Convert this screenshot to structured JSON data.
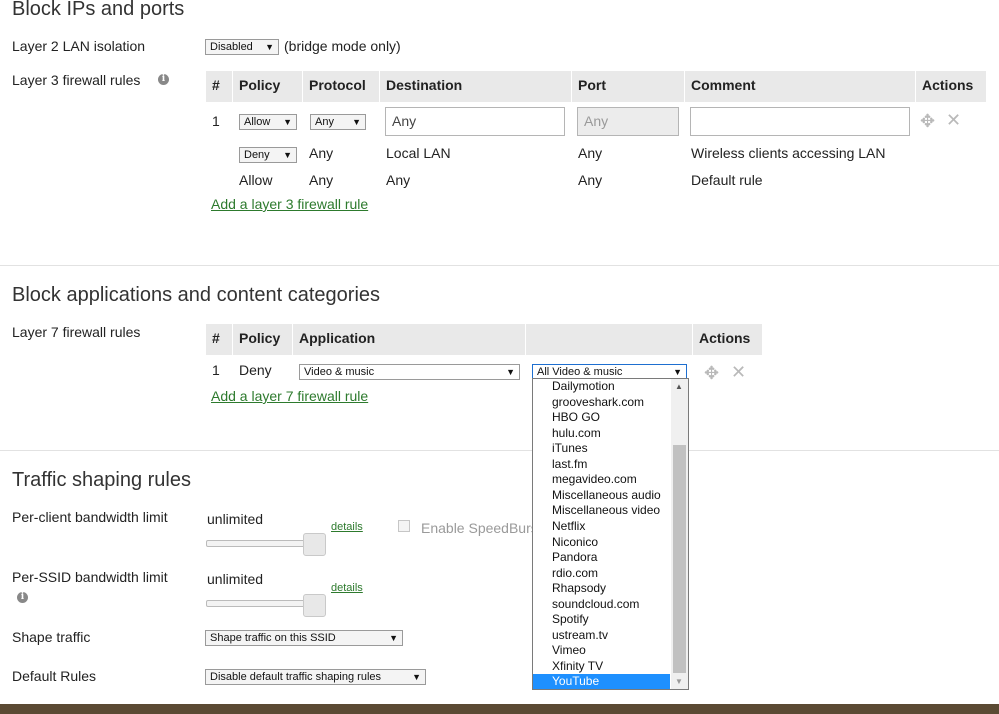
{
  "block_ips": {
    "title": "Block IPs and ports",
    "l2_label": "Layer 2 LAN isolation",
    "l2_value": "Disabled",
    "l2_note": "(bridge mode only)",
    "l3_label": "Layer 3 firewall rules",
    "table_headers": [
      "#",
      "Policy",
      "Protocol",
      "Destination",
      "Port",
      "Comment",
      "Actions"
    ],
    "rule1": {
      "num": "1",
      "policy": "Allow",
      "protocol": "Any",
      "destination": "Any",
      "port_placeholder": "Any",
      "comment": ""
    },
    "rule2": {
      "policy": "Deny",
      "protocol": "Any",
      "destination": "Local LAN",
      "port": "Any",
      "comment": "Wireless clients accessing LAN"
    },
    "rule3": {
      "policy": "Allow",
      "protocol": "Any",
      "destination": "Any",
      "port": "Any",
      "comment": "Default rule"
    },
    "add_link": "Add a layer 3 firewall rule"
  },
  "block_apps": {
    "title": "Block applications and content categories",
    "l7_label": "Layer 7 firewall rules",
    "table_headers": [
      "#",
      "Policy",
      "Application",
      "",
      "Actions"
    ],
    "rule1": {
      "num": "1",
      "policy": "Deny",
      "application": "Video & music",
      "subcategory": "All Video & music"
    },
    "add_link": "Add a layer 7 firewall rule",
    "dropdown_options": [
      "Dailymotion",
      "grooveshark.com",
      "HBO GO",
      "hulu.com",
      "iTunes",
      "last.fm",
      "megavideo.com",
      "Miscellaneous audio",
      "Miscellaneous video",
      "Netflix",
      "Niconico",
      "Pandora",
      "rdio.com",
      "Rhapsody",
      "soundcloud.com",
      "Spotify",
      "ustream.tv",
      "Vimeo",
      "Xfinity TV",
      "YouTube"
    ],
    "dropdown_selected": "YouTube"
  },
  "traffic": {
    "title": "Traffic shaping rules",
    "per_client_label": "Per-client bandwidth limit",
    "per_client_value": "unlimited",
    "per_client_details": "details",
    "speedburst_label": "Enable SpeedBurst",
    "per_ssid_label": "Per-SSID bandwidth limit",
    "per_ssid_value": "unlimited",
    "per_ssid_details": "details",
    "shape_label": "Shape traffic",
    "shape_value": "Shape traffic on this SSID",
    "default_label": "Default Rules",
    "default_value": "Disable default traffic shaping rules"
  },
  "colors": {
    "link": "#2d7a2d",
    "header_bg": "#e9e9e9",
    "selected_bg": "#1e90ff"
  }
}
